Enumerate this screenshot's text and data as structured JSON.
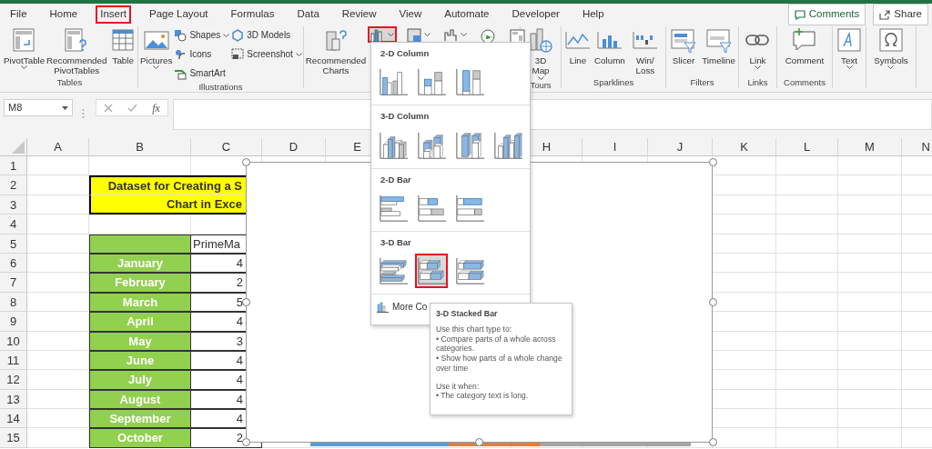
{
  "tabs": [
    {
      "label": "File",
      "selected": false
    },
    {
      "label": "Home",
      "selected": false
    },
    {
      "label": "Insert",
      "selected": true
    },
    {
      "label": "Page Layout",
      "selected": false
    },
    {
      "label": "Formulas",
      "selected": false
    },
    {
      "label": "Data",
      "selected": false
    },
    {
      "label": "Review",
      "selected": false
    },
    {
      "label": "View",
      "selected": false
    },
    {
      "label": "Automate",
      "selected": false
    },
    {
      "label": "Developer",
      "selected": false
    },
    {
      "label": "Help",
      "selected": false
    }
  ],
  "header_buttons": [
    {
      "label": "Comments",
      "kind": "comments"
    },
    {
      "label": "Share",
      "kind": "share"
    }
  ],
  "ribbon": {
    "groups": [
      {
        "label": "Tables",
        "items": [
          {
            "kind": "large",
            "label": "PivotTable",
            "dropdown": true
          },
          {
            "kind": "large",
            "label": "Recommended PivotTables",
            "dropdown": false
          },
          {
            "kind": "large",
            "label": "Table",
            "dropdown": false
          }
        ]
      },
      {
        "label": "Illustrations",
        "items": [
          {
            "kind": "large",
            "label": "Pictures",
            "dropdown": true
          },
          {
            "kind": "small",
            "label": "Shapes",
            "dropdown": true
          },
          {
            "kind": "small",
            "label": "Icons",
            "dropdown": false
          },
          {
            "kind": "small",
            "label": "SmartArt",
            "dropdown": false
          },
          {
            "kind": "small",
            "label": "3D Models",
            "dropdown": false
          },
          {
            "kind": "small",
            "label": "Screenshot",
            "dropdown": true
          }
        ]
      },
      {
        "items": [
          {
            "kind": "large",
            "label": "Recommended Charts",
            "dropdown": false
          },
          {
            "kind": "tool",
            "dropdown": true,
            "selected": true
          },
          {
            "kind": "tool",
            "dropdown": true,
            "selected": false
          },
          {
            "kind": "tool",
            "dropdown": true,
            "selected": false
          },
          {
            "kind": "tool",
            "dropdown": false,
            "selected": false
          },
          {
            "kind": "tool",
            "dropdown": false,
            "selected": false
          }
        ]
      },
      {
        "label": "Tours",
        "items": [
          {
            "kind": "large",
            "label": "3D Map",
            "dropdown": true
          }
        ]
      },
      {
        "label": "Sparklines",
        "items": [
          {
            "kind": "large",
            "label": "Line",
            "dropdown": false
          },
          {
            "kind": "large",
            "label": "Column",
            "dropdown": false
          },
          {
            "kind": "large",
            "label": "Win/Loss",
            "dropdown": false
          }
        ]
      },
      {
        "label": "Filters",
        "items": [
          {
            "kind": "large",
            "label": "Slicer",
            "dropdown": false
          },
          {
            "kind": "large",
            "label": "Timeline",
            "dropdown": false
          }
        ]
      },
      {
        "label": "Links",
        "items": [
          {
            "kind": "large",
            "label": "Link",
            "dropdown": true
          }
        ]
      },
      {
        "label": "Comments",
        "items": [
          {
            "kind": "large",
            "label": "Comment",
            "dropdown": false
          }
        ]
      },
      {
        "items": [
          {
            "kind": "large",
            "label": "Text",
            "dropdown": true
          }
        ]
      },
      {
        "items": [
          {
            "kind": "large",
            "label": "Symbols",
            "dropdown": true
          }
        ]
      }
    ]
  },
  "formula_bar": {
    "name_box": "M8",
    "function_label": "fx"
  },
  "columns": [
    "A",
    "B",
    "C",
    "D",
    "E",
    "H",
    "I",
    "J",
    "K",
    "L",
    "M",
    "N"
  ],
  "rows": [
    {
      "number": "1"
    },
    {
      "number": "2",
      "kind": "title",
      "text": "Dataset for Creating a S"
    },
    {
      "number": "3",
      "kind": "title",
      "text": "Chart in Exce"
    },
    {
      "number": "4"
    },
    {
      "number": "5",
      "kind": "header",
      "value": "PrimeMa"
    },
    {
      "number": "6",
      "kind": "month",
      "label": "January",
      "value": "4"
    },
    {
      "number": "7",
      "kind": "month",
      "label": "February",
      "value": "2"
    },
    {
      "number": "8",
      "kind": "month",
      "label": "March",
      "value": "5"
    },
    {
      "number": "9",
      "kind": "month",
      "label": "April",
      "value": "4"
    },
    {
      "number": "10",
      "kind": "month",
      "label": "May",
      "value": "3"
    },
    {
      "number": "11",
      "kind": "month",
      "label": "June",
      "value": "4"
    },
    {
      "number": "12",
      "kind": "month",
      "label": "July",
      "value": "4"
    },
    {
      "number": "13",
      "kind": "month",
      "label": "August",
      "value": "4"
    },
    {
      "number": "14",
      "kind": "month",
      "label": "September",
      "value": "4"
    },
    {
      "number": "15",
      "kind": "month",
      "label": "October",
      "value": "2"
    }
  ],
  "chart_menu": {
    "sections": [
      {
        "title": "2-D Column",
        "kind": "column",
        "options": [
          {
            "selected": false
          },
          {
            "selected": false
          },
          {
            "selected": false
          }
        ]
      },
      {
        "title": "3-D Column",
        "kind": "column3d",
        "options": [
          {
            "selected": false
          },
          {
            "selected": false
          },
          {
            "selected": false
          },
          {
            "selected": false
          }
        ]
      },
      {
        "title": "2-D Bar",
        "kind": "bar",
        "options": [
          {
            "selected": false
          },
          {
            "selected": false
          },
          {
            "selected": false
          }
        ]
      },
      {
        "title": "3-D Bar",
        "kind": "bar3d",
        "options": [
          {
            "selected": false
          },
          {
            "selected": true
          },
          {
            "selected": false
          }
        ]
      }
    ],
    "more_link": "More Co"
  },
  "tooltip": {
    "title": "3-D Stacked Bar",
    "paragraphs": [
      [
        "Use this chart type to:",
        "• Compare parts of a whole across categories.",
        "• Show how parts of a whole change over time"
      ],
      [
        "Use it when:",
        "• The category text is long."
      ]
    ]
  }
}
